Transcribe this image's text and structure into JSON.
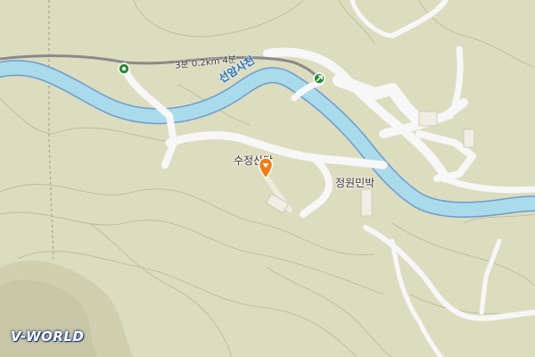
{
  "map": {
    "river_name": "선암사천",
    "route_label": "3분 0.2km 4분",
    "places": [
      {
        "name": "수정산당",
        "icon": "map-pin-icon"
      },
      {
        "name": "정원민박"
      }
    ],
    "nodes": [
      {
        "icon": "green-start-node-icon"
      },
      {
        "icon": "green-direction-arrow-icon"
      }
    ],
    "logo_text": "V-WORLD",
    "colors": {
      "land": "#dcdcbf",
      "river": "#a9dbea",
      "river_edge": "#6f9bd0",
      "road": "#f7f7f7",
      "route": "#8a8a8a",
      "marker": "#f07d1a",
      "node": "#2e8b3b"
    }
  }
}
